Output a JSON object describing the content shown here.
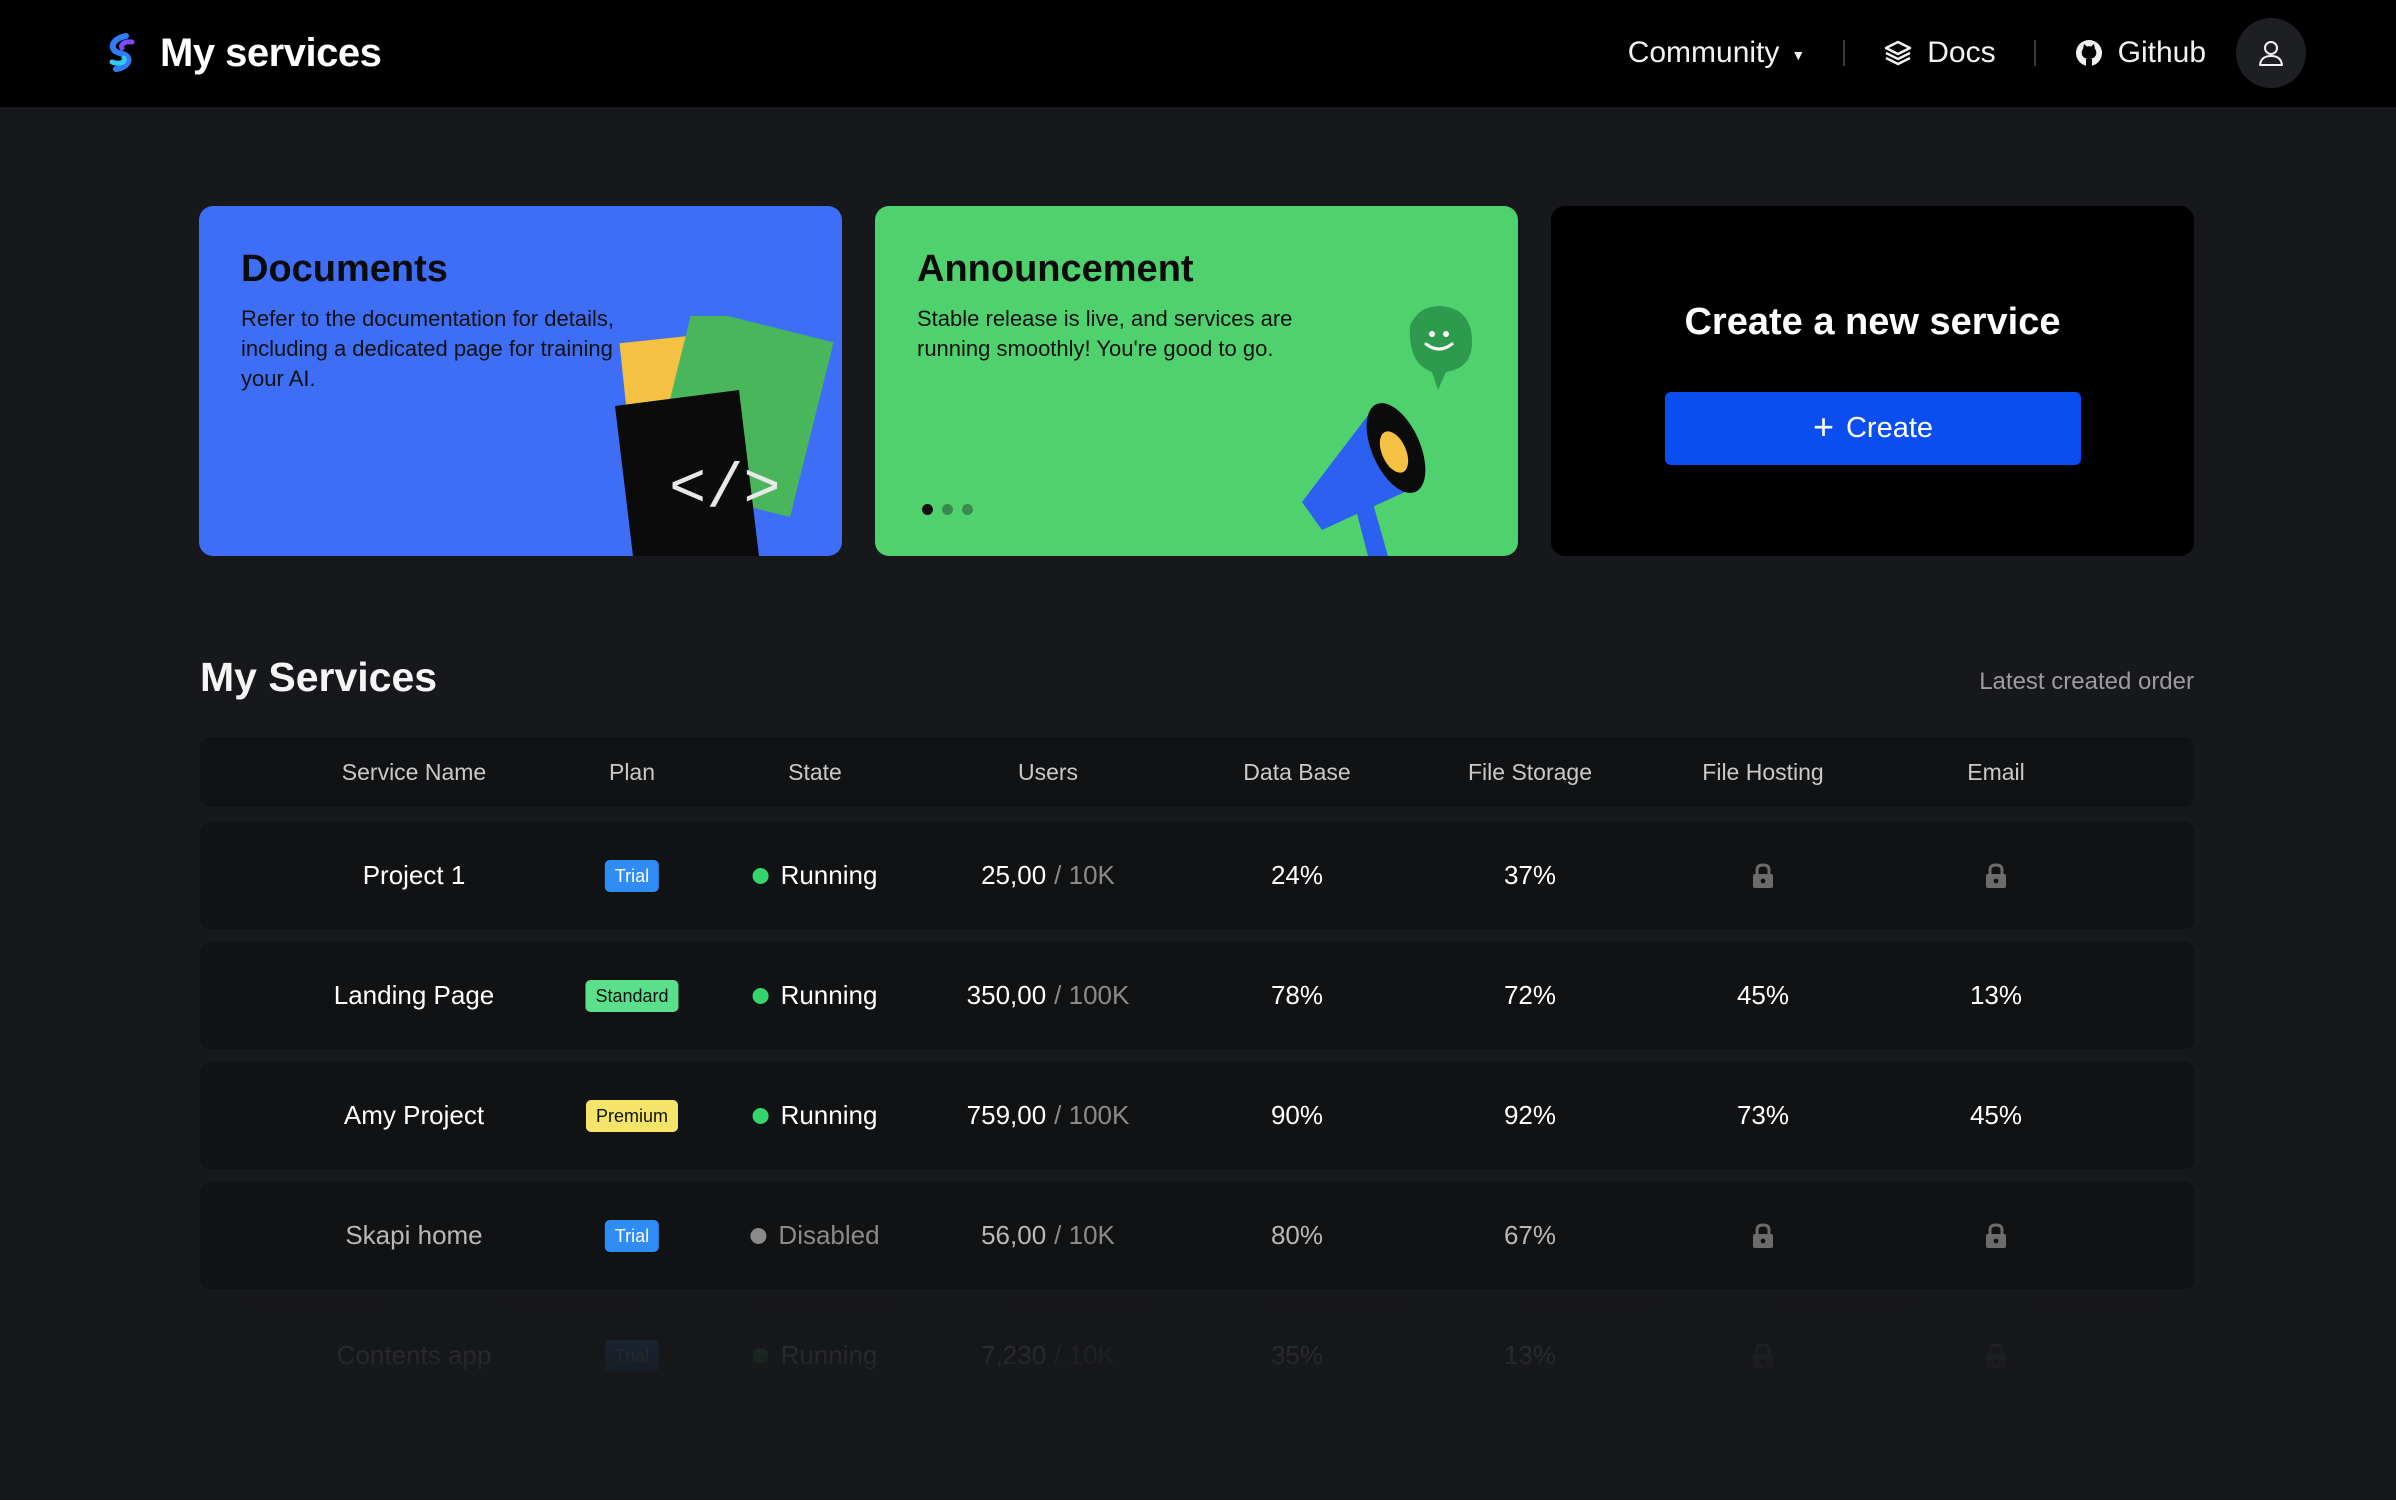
{
  "header": {
    "title": "My services",
    "nav": {
      "community": "Community",
      "docs": "Docs",
      "github": "Github"
    }
  },
  "cards": {
    "documents": {
      "title": "Documents",
      "text": "Refer to the documentation for details, including a dedicated page for training your AI."
    },
    "announcement": {
      "title": "Announcement",
      "text": "Stable release is live, and services are running smoothly! You're good to go.",
      "slides": 3,
      "active_slide": 1
    },
    "create": {
      "title": "Create a new service",
      "button": "Create"
    }
  },
  "services": {
    "title": "My Services",
    "sort": "Latest created order",
    "columns": [
      "Service Name",
      "Plan",
      "State",
      "Users",
      "Data Base",
      "File Storage",
      "File Hosting",
      "Email"
    ],
    "rows": [
      {
        "name": "Project 1",
        "plan": "Trial",
        "state": "Running",
        "users": "25,00",
        "limit": "/ 10K",
        "database": "24%",
        "storage": "37%",
        "hosting": "locked",
        "email": "locked"
      },
      {
        "name": "Landing Page",
        "plan": "Standard",
        "state": "Running",
        "users": "350,00",
        "limit": "/ 100K",
        "database": "78%",
        "storage": "72%",
        "hosting": "45%",
        "email": "13%"
      },
      {
        "name": "Amy Project",
        "plan": "Premium",
        "state": "Running",
        "users": "759,00",
        "limit": "/ 100K",
        "database": "90%",
        "storage": "92%",
        "hosting": "73%",
        "email": "45%"
      },
      {
        "name": "Skapi home",
        "plan": "Trial",
        "state": "Disabled",
        "users": "56,00",
        "limit": "/ 10K",
        "database": "80%",
        "storage": "67%",
        "hosting": "locked",
        "email": "locked"
      },
      {
        "name": "Contents app",
        "plan": "Trial",
        "state": "Running",
        "users": "7,230",
        "limit": "/ 10K",
        "database": "35%",
        "storage": "13%",
        "hosting": "locked",
        "email": "locked"
      }
    ]
  },
  "colors": {
    "background": "#17181b",
    "topbar": "#000000",
    "documents_card": "#3d6ef5",
    "announcement_card": "#4fd16e",
    "create_button": "#0a4ef0",
    "running": "#35d46a",
    "disabled": "#8a8a8a",
    "plan_trial": "#2f8cf5",
    "plan_standard": "#5ae08a",
    "plan_premium": "#f5e46a"
  },
  "icons": {
    "brand": "brand-logo-icon",
    "docs": "layers-icon",
    "github": "github-icon",
    "profile": "user-icon",
    "locked": "lock-icon"
  }
}
